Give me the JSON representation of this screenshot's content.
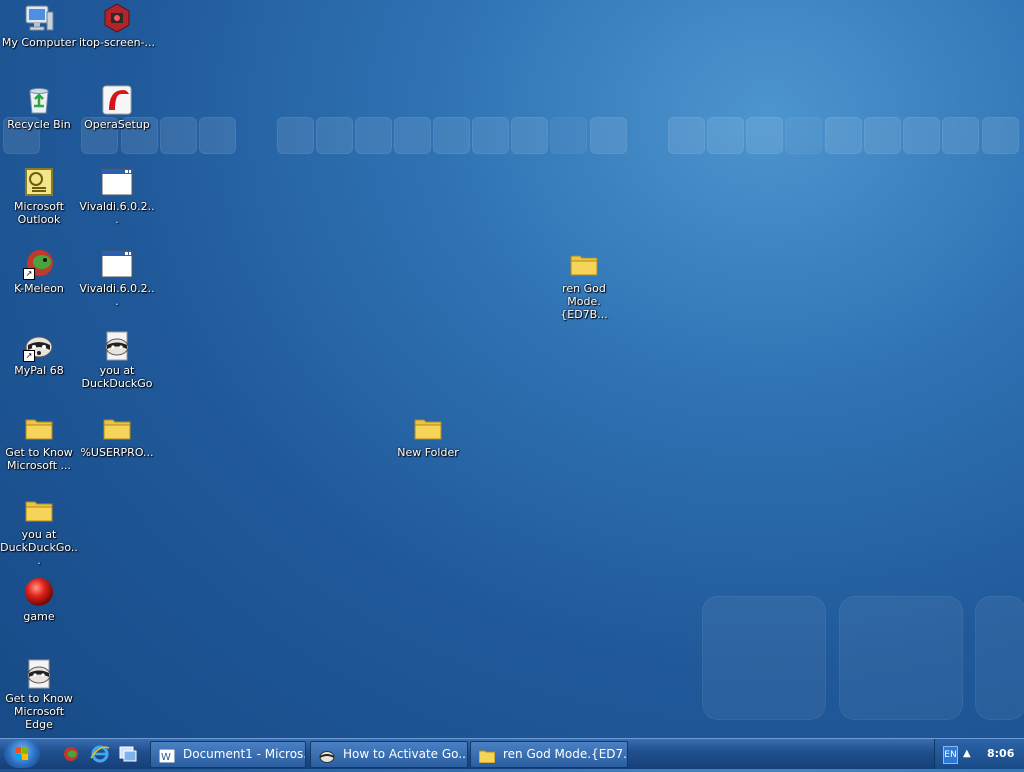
{
  "desktop_icons": [
    {
      "label": "My Computer",
      "icon": "computer-icon"
    },
    {
      "label": "itop-screen-...",
      "icon": "screen-recorder-icon"
    },
    {
      "label": "Recycle Bin",
      "icon": "recycle-bin-icon"
    },
    {
      "label": "OperaSetup",
      "icon": "opera-installer-icon"
    },
    {
      "label": "Microsoft Outlook",
      "icon": "outlook-icon"
    },
    {
      "label": "Vivaldi.6.0.2...",
      "icon": "window-app-icon"
    },
    {
      "label": "K-Meleon",
      "icon": "k-meleon-icon"
    },
    {
      "label": "Vivaldi.6.0.2...",
      "icon": "window-app-icon"
    },
    {
      "label": "MyPal 68",
      "icon": "mypal-icon"
    },
    {
      "label": "you at DuckDuckGo",
      "icon": "mypal-document-icon"
    },
    {
      "label": "Get to Know Microsoft ...",
      "icon": "folder-icon"
    },
    {
      "label": "%USERPRO...",
      "icon": "folder-icon"
    },
    {
      "label": "you at DuckDuckGo...",
      "icon": "folder-icon"
    },
    {
      "label": "game",
      "icon": "red-ball-icon"
    },
    {
      "label": "Get to Know Microsoft Edge",
      "icon": "mypal-document-icon"
    },
    {
      "label": "ren God Mode.{ED7B...",
      "icon": "folder-icon"
    },
    {
      "label": "New Folder",
      "icon": "folder-icon"
    }
  ],
  "taskbar": {
    "start_button": "start-orb-icon",
    "quick_launch": [
      "browser-icon",
      "internet-explorer-icon",
      "switch-windows-icon"
    ],
    "buttons": [
      {
        "label": "Document1 - Micros...",
        "icon": "word-icon"
      },
      {
        "label": "How to Activate Go...",
        "icon": "mypal-icon"
      },
      {
        "label": "ren God Mode.{ED7...",
        "icon": "folder-icon"
      }
    ],
    "tray": {
      "language": "EN",
      "clock": "8:06"
    }
  },
  "colors": {
    "desktop_bg": "#2f73b4",
    "taskbar_bg": "#20508f",
    "folder_yellow": "#f6d45a"
  }
}
